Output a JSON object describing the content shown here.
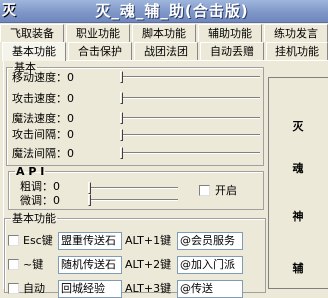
{
  "window": {
    "icon_glyph": "灭",
    "title": "灭_魂_辅_助(合击版)"
  },
  "tabs_row1": [
    {
      "label": "飞取装备"
    },
    {
      "label": "职业功能"
    },
    {
      "label": "脚本功能"
    },
    {
      "label": "辅助功能"
    },
    {
      "label": "练功发言"
    }
  ],
  "tabs_row2": [
    {
      "label": "基本功能",
      "active": true
    },
    {
      "label": "合击保护"
    },
    {
      "label": "战团法团"
    },
    {
      "label": "自动丢赠"
    },
    {
      "label": "挂机功能"
    }
  ],
  "basic": {
    "legend": "基本",
    "sliders": [
      {
        "label": "移动速度：",
        "value": "0"
      },
      {
        "label": "攻击速度：",
        "value": "0"
      },
      {
        "label": "魔法速度：",
        "value": "0"
      },
      {
        "label": "攻击间隔：",
        "value": "0"
      },
      {
        "label": "魔法间隔：",
        "value": "0"
      }
    ]
  },
  "api": {
    "legend": "A P I",
    "coarse_label": "粗调：",
    "coarse_value": "0",
    "fine_label": "微调：",
    "fine_value": "0",
    "enable_label": "开启"
  },
  "features": {
    "legend": "基本功能",
    "rows": [
      {
        "key_label": "Esc键",
        "item": "盟重传送石",
        "hotkey": "ALT+1键",
        "message": "@会员服务"
      },
      {
        "key_label": "~键",
        "item": "随机传送石",
        "hotkey": "ALT+2键",
        "message": "@加入门派"
      },
      {
        "key_label": "自动",
        "item": "回城经验",
        "hotkey": "ALT+3键",
        "message": "@传送"
      }
    ]
  },
  "sidebar": {
    "chars": [
      "灭",
      "魂",
      "神",
      "辅"
    ]
  }
}
